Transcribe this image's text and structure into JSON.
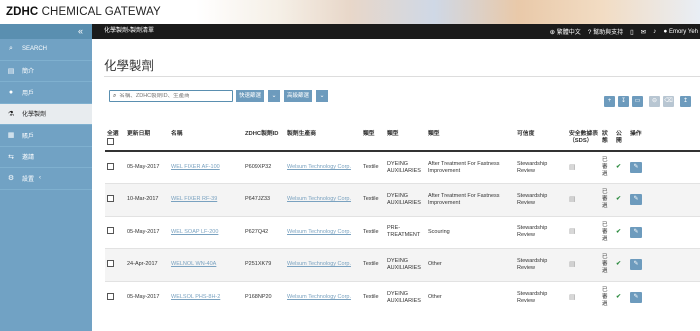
{
  "brand": {
    "name_bold": "ZDHC",
    "name_rest": " CHEMICAL GATEWAY"
  },
  "topbar": {
    "collapse_icon": "«",
    "breadcrumb": [
      "化學製劑",
      "製劑清單"
    ],
    "breadcrumb_sep": " › ",
    "language": "繁體中文",
    "help": "幫助與支持",
    "user": "Emory Yeh"
  },
  "sidebar": {
    "items": [
      {
        "icon": "search-icon",
        "glyph": "⌕",
        "label": "SEARCH"
      },
      {
        "icon": "id-card-icon",
        "glyph": "▤",
        "label": "簡介"
      },
      {
        "icon": "user-icon",
        "glyph": "●",
        "label": "用戶"
      },
      {
        "icon": "flask-icon",
        "glyph": "⚗",
        "label": "化學製劑",
        "active": true
      },
      {
        "icon": "grid-icon",
        "glyph": "▦",
        "label": "賬戶"
      },
      {
        "icon": "share-icon",
        "glyph": "⇆",
        "label": "邀請"
      },
      {
        "icon": "gear-icon",
        "glyph": "⚙",
        "label": "設置",
        "chevron": "‹"
      }
    ]
  },
  "main": {
    "title": "化學製劑",
    "search": {
      "placeholder": "名稱、ZDHC製劑ID、生產商"
    },
    "quick_filter": "快速篩選",
    "advanced_filter": "高級篩選",
    "columns": [
      "全選",
      "更新日期",
      "名稱",
      "ZDHC製劑ID",
      "製劑生產商",
      "類型",
      "類型",
      "類型",
      "可信度",
      "安全數據表（SDS）",
      "狀態",
      "公開",
      "操作"
    ],
    "rows": [
      {
        "date": "05-May-2017",
        "name": "WEL FIXER AF-100",
        "zdhc_id": "P609XP32",
        "maker": "Welsum Technology Corp.",
        "type1": "Textile",
        "type2": "DYEING AUXILIARIES",
        "type3": "After Treatment For Fastness Improvement",
        "trust": "Stewardship Review",
        "status": "已審過"
      },
      {
        "date": "10-Mar-2017",
        "name": "WEL FIXER RF-39",
        "zdhc_id": "P647JZ33",
        "maker": "Welsum Technology Corp.",
        "type1": "Textile",
        "type2": "DYEING AUXILIARIES",
        "type3": "After Treatment For Fastness Improvement",
        "trust": "Stewardship Review",
        "status": "已審過"
      },
      {
        "date": "05-May-2017",
        "name": "WEL SOAP LF-200",
        "zdhc_id": "P627Q42",
        "maker": "Welsum Technology Corp.",
        "type1": "Textile",
        "type2": "PRE-TREATMENT",
        "type3": "Scouring",
        "trust": "Stewardship Review",
        "status": "已審過"
      },
      {
        "date": "24-Apr-2017",
        "name": "WELNOL WN-40A",
        "zdhc_id": "P251XK79",
        "maker": "Welsum Technology Corp.",
        "type1": "Textile",
        "type2": "DYEING AUXILIARIES",
        "type3": "Other",
        "trust": "Stewardship Review",
        "status": "已審過"
      },
      {
        "date": "05-May-2017",
        "name": "WELSOL PHS-8H-2",
        "zdhc_id": "P168NP20",
        "maker": "Welsum Technology Corp.",
        "type1": "Textile",
        "type2": "DYEING AUXILIARIES",
        "type3": "Other",
        "trust": "Stewardship Review",
        "status": "已審過"
      }
    ]
  },
  "colors": {
    "accent": "#6d9bbd",
    "sidebar": "#71a2c4",
    "link": "#7aa2c0",
    "check": "#2b8a3e"
  }
}
